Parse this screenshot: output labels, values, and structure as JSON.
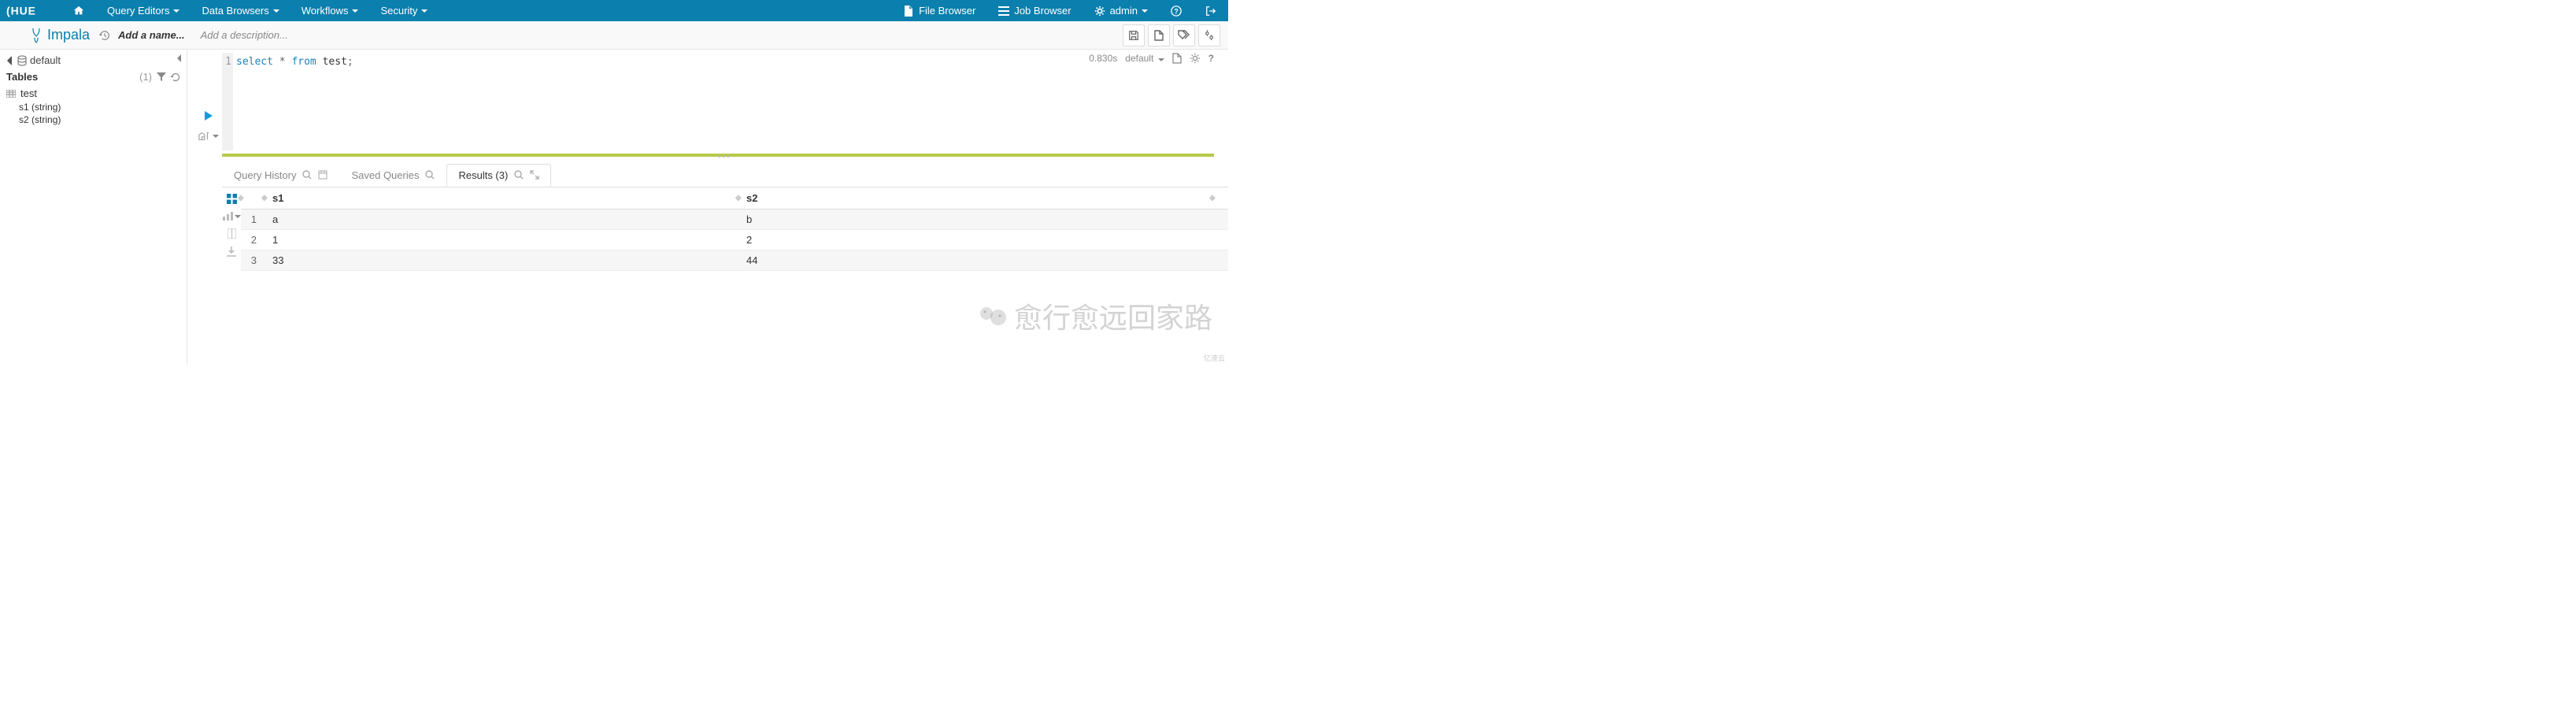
{
  "brand": "HUE",
  "topnav": {
    "left": [
      {
        "id": "home",
        "label": "",
        "icon": "home"
      },
      {
        "id": "query-editors",
        "label": "Query Editors",
        "dropdown": true
      },
      {
        "id": "data-browsers",
        "label": "Data Browsers",
        "dropdown": true
      },
      {
        "id": "workflows",
        "label": "Workflows",
        "dropdown": true
      },
      {
        "id": "security",
        "label": "Security",
        "dropdown": true
      }
    ],
    "right": [
      {
        "id": "file-browser",
        "label": "File Browser",
        "icon": "file"
      },
      {
        "id": "job-browser",
        "label": "Job Browser",
        "icon": "list"
      },
      {
        "id": "admin",
        "label": "admin",
        "icon": "cog",
        "dropdown": true
      },
      {
        "id": "help",
        "label": "",
        "icon": "help"
      },
      {
        "id": "signout",
        "label": "",
        "icon": "signout"
      }
    ]
  },
  "subbar": {
    "engine": "Impala",
    "name_placeholder": "Add a name...",
    "desc_placeholder": "Add a description..."
  },
  "sidebar": {
    "database": "default",
    "tables_label": "Tables",
    "tables_count": "(1)",
    "tables": [
      {
        "name": "test",
        "columns": [
          {
            "name": "s1",
            "type": "(string)"
          },
          {
            "name": "s2",
            "type": "(string)"
          }
        ]
      }
    ]
  },
  "editor": {
    "line_no": "1",
    "sql_select": "select",
    "sql_star": "*",
    "sql_from": "from",
    "sql_table": "test",
    "sql_semi": ";",
    "exec_time": "0.830s",
    "db_selector": "default"
  },
  "tabs": {
    "history": "Query History",
    "saved": "Saved Queries",
    "results_label": "Results (3)"
  },
  "results": {
    "columns": [
      "s1",
      "s2"
    ],
    "rows": [
      {
        "n": "1",
        "s1": "a",
        "s2": "b"
      },
      {
        "n": "2",
        "s1": "1",
        "s2": "2"
      },
      {
        "n": "3",
        "s1": "33",
        "s2": "44"
      }
    ]
  },
  "watermark": "愈行愈远回家路",
  "corner": "亿速云"
}
